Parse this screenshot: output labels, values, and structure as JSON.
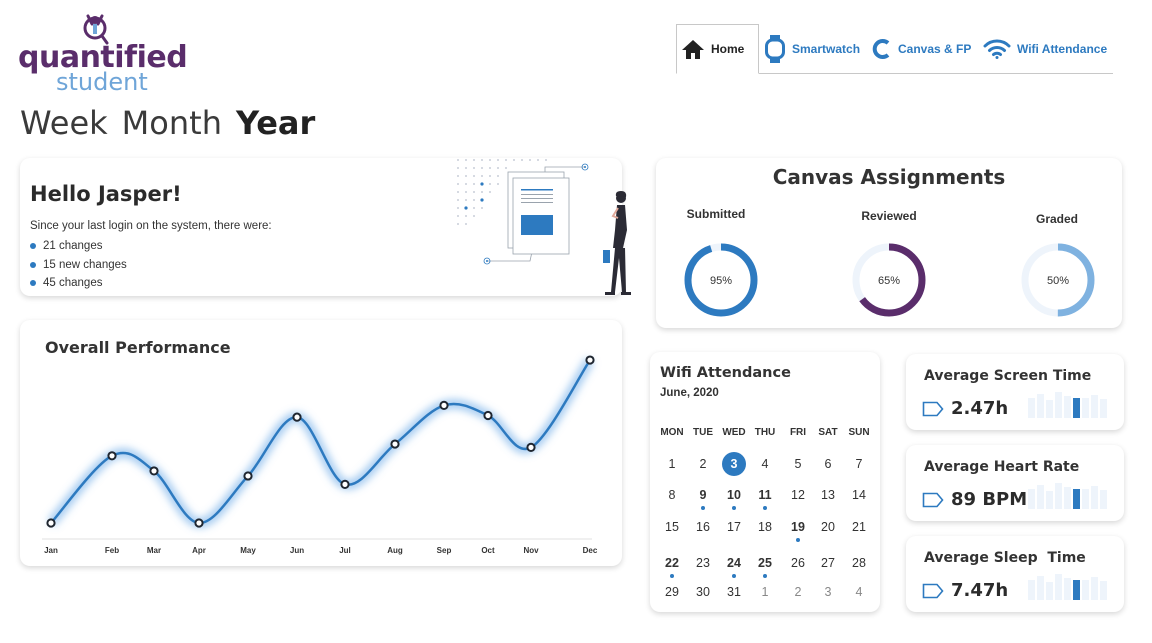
{
  "brand": {
    "line1": "quantified",
    "line2": "student"
  },
  "nav": {
    "tabs": [
      {
        "label": "Home",
        "icon": "home-icon",
        "active": true
      },
      {
        "label": "Smartwatch",
        "icon": "smartwatch-icon"
      },
      {
        "label": "Canvas & FP",
        "icon": "canvas-icon"
      },
      {
        "label": "Wifi Attendance",
        "icon": "wifi-icon"
      }
    ]
  },
  "period": {
    "week": "Week",
    "month": "Month",
    "year": "Year",
    "selected": "Year"
  },
  "greeting": {
    "title": "Hello Jasper!",
    "intro": "Since your last login on the system, there were:",
    "items": [
      "21 changes",
      "15 new changes",
      "45 changes"
    ]
  },
  "performance": {
    "title": "Overall Performance",
    "chart_data": {
      "type": "line",
      "categories": [
        "Jan",
        "Feb",
        "Mar",
        "Apr",
        "May",
        "Jun",
        "Jul",
        "Aug",
        "Sep",
        "Oct",
        "Nov",
        "Dec"
      ],
      "values": [
        0,
        40,
        31,
        0,
        28,
        63,
        23,
        47,
        70,
        64,
        45,
        97
      ],
      "ylim": [
        0,
        100
      ],
      "grid": false,
      "color": "#2d7ac0"
    }
  },
  "canvas": {
    "title": "Canvas Assignments",
    "items": [
      {
        "label": "Submitted",
        "percent": 95,
        "text": "95%",
        "color": "#2d7ac0"
      },
      {
        "label": "Reviewed",
        "percent": 65,
        "text": "65%",
        "color": "#5a2d6b"
      },
      {
        "label": "Graded",
        "percent": 50,
        "text": "50%",
        "color": "#7fb2e0"
      }
    ]
  },
  "wifi": {
    "title": "Wifi Attendance",
    "month": "June, 2020",
    "weekdays": [
      "MON",
      "TUE",
      "WED",
      "THU",
      "FRI",
      "SAT",
      "SUN"
    ],
    "weeks": [
      [
        "1",
        "2",
        "3",
        "4",
        "5",
        "6",
        "7"
      ],
      [
        "8",
        "9",
        "10",
        "11",
        "12",
        "13",
        "14"
      ],
      [
        "15",
        "16",
        "17",
        "18",
        "19",
        "20",
        "21"
      ],
      [
        "22",
        "23",
        "24",
        "25",
        "26",
        "27",
        "28"
      ],
      [
        "29",
        "30",
        "31",
        "1",
        "2",
        "3",
        "4"
      ]
    ],
    "selected_day": "3",
    "attended_days": [
      "9",
      "10",
      "11",
      "19",
      "22",
      "24",
      "25"
    ]
  },
  "stats": [
    {
      "title": "Average Screen Time",
      "value": "2.47h"
    },
    {
      "title": "Average Heart Rate",
      "value": "89 BPM"
    },
    {
      "title": "Average Sleep  Time",
      "value": "7.47h"
    }
  ],
  "colors": {
    "accent": "#2d7ac0",
    "brand_purple": "#5a2d6b",
    "brand_blue": "#6fa5d8"
  }
}
